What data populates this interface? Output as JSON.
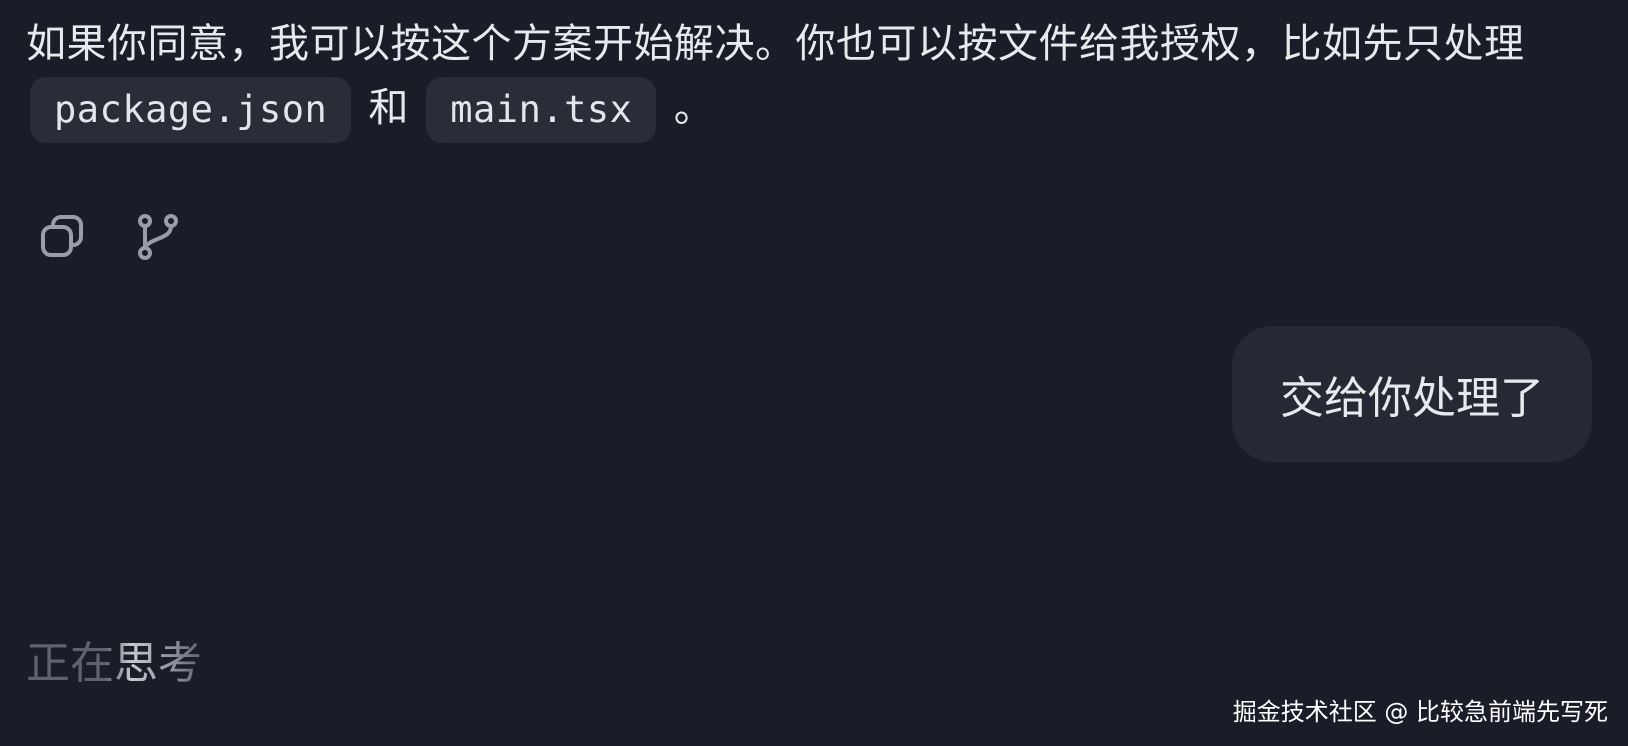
{
  "assistant_message": {
    "text_part1": "如果你同意，我可以按这个方案开始解决。你也可以按文件给我授权，比如先只处理",
    "code1": "package.json",
    "text_part2": "和",
    "code2": "main.tsx",
    "text_part3": "。"
  },
  "actions": {
    "copy_icon": "copy-icon",
    "branch_icon": "branch-icon"
  },
  "user_message": {
    "text": "交给你处理了"
  },
  "status": {
    "thinking": "正在思考"
  },
  "watermark": {
    "text": "掘金技术社区 @ 比较急前端先写死"
  },
  "colors": {
    "background": "#1a1d27",
    "bubble": "#262833",
    "code_chip": "#2a2d38",
    "text": "#e8e9ed",
    "muted": "#5f626d"
  }
}
